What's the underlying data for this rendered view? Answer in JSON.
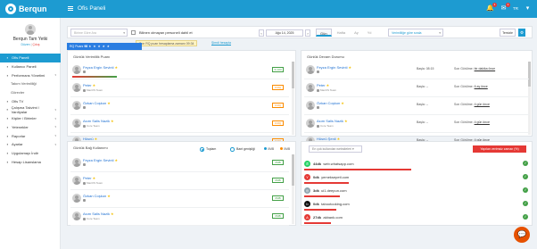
{
  "header": {
    "logo": "Berqun",
    "title": "Ofis Paneli",
    "notif_count": "1",
    "msg_count": "1",
    "lang": "TR"
  },
  "user": {
    "name": "Berqun Tam Yetki",
    "edit": "Düzen",
    "logout": "Çıkış"
  },
  "sidebar": {
    "items": [
      {
        "label": "Ofis Paneli",
        "icon": "home-icon",
        "active": true
      },
      {
        "label": "Kullanıcı Paneli",
        "icon": "user-icon"
      },
      {
        "label": "Performans Yönetimi",
        "icon": "chart-icon",
        "chev": true
      },
      {
        "label": "Takım Verimliliği",
        "sub": true
      },
      {
        "label": "Görevler",
        "sub": true
      },
      {
        "label": "Ofis TV",
        "icon": "tv-icon"
      },
      {
        "label": "Çalışma Takvimi / Vardiyalar",
        "icon": "calendar-icon",
        "chev": true
      },
      {
        "label": "Kişiler / Birimler",
        "icon": "users-icon",
        "chev": true
      },
      {
        "label": "Yetenekler",
        "icon": "star-icon",
        "chev": true
      },
      {
        "label": "Raporlar",
        "icon": "report-icon",
        "chev": true
      },
      {
        "label": "Ayarlar",
        "icon": "gear-icon",
        "chev": true
      },
      {
        "label": "Uygulamayı İndir",
        "icon": "download-icon"
      },
      {
        "label": "Hesap Lisanslama",
        "icon": "license-icon"
      }
    ]
  },
  "filter": {
    "unit_placeholder": "Birime Göre Ara",
    "unregistered_label": "Bilinen olmayan personeli dahil et",
    "date": "Ağu 14, 2025",
    "tabs": [
      "Gün",
      "Hafta",
      "Ay",
      "Yıl"
    ],
    "view": "Verimliliğe göre sırala",
    "clear": "Temizle"
  },
  "alert": {
    "text": "Son RQ puan hesaplama zamanı 09:34",
    "link": "Şimdi hesapla"
  },
  "rq_badge": {
    "label": "RQ Puanı",
    "value": "98",
    "stars": "★ ★ ★ ★ ★"
  },
  "efficiency": {
    "title": "Günlük Verimlilik Puanı",
    "rows": [
      {
        "name": "Feyza Ergin Sevinti",
        "sub": "",
        "badge": "% 100",
        "color": "#43a047",
        "fill": 0.9
      },
      {
        "name": "Peter",
        "sub": "MacOS Team",
        "badge": "0 RQ",
        "color": "#fb8c00",
        "fill": 0
      },
      {
        "name": "Özkan Coşkun",
        "sub": "",
        "badge": "0 RQ",
        "color": "#fb8c00",
        "fill": 0
      },
      {
        "name": "Asım Salis Nazik",
        "sub": "Core Team",
        "badge": "0 RQ",
        "color": "#fb8c00",
        "fill": 0
      },
      {
        "name": "Hüsnü",
        "sub": "",
        "badge": "0 RQ",
        "color": "#fb8c00",
        "fill": 0
      }
    ]
  },
  "connection": {
    "title": "Günlük Bağ Kullanımı",
    "radio_all": "Toplam",
    "radio_unread": "Bant genişliği",
    "legend_dl": "0MB",
    "legend_ul": "0MB",
    "rows": [
      {
        "name": "Feyza Ergin Sevinti",
        "sub": "",
        "badge": "0MB"
      },
      {
        "name": "Peter",
        "sub": "MacOS Team",
        "badge": "0MB"
      },
      {
        "name": "Özkan Coşkun",
        "sub": "",
        "badge": "0MB"
      },
      {
        "name": "Asım Salis Nazik",
        "sub": "Core Team",
        "badge": "0MB"
      }
    ]
  },
  "status": {
    "title": "Günlük Devam Durumu",
    "rows": [
      {
        "name": "Feyza Ergin Sevinti",
        "sub": "",
        "start": "Başla: 08:15",
        "seen": "Son Görülme:",
        "seen_val": "bir dakika önce"
      },
      {
        "name": "Peter",
        "sub": "MacOS Team",
        "start": "Başla: --",
        "seen": "Son Görülme:",
        "seen_val": "6 ay önce"
      },
      {
        "name": "Özkan Coşkun",
        "sub": "",
        "start": "Başla: --",
        "seen": "Son Görülme:",
        "seen_val": "4 gün önce"
      },
      {
        "name": "Asım Salis Nazik",
        "sub": "Core Team",
        "start": "Başla: --",
        "seen": "Son Görülme:",
        "seen_val": "4 gün önce"
      },
      {
        "name": "Hüsnü Şenli",
        "sub": "",
        "start": "Başla: --",
        "seen": "Son Görülme:",
        "seen_val": "4 gün önce"
      }
    ]
  },
  "sites": {
    "select": "En çok kullanılan websiteleri",
    "button": "Yapılan verimsiz zaman (%)",
    "rows": [
      {
        "time": "44dk",
        "site": "web.whatsapp.com",
        "icon": "whatsapp-icon",
        "color": "#25d366",
        "glyph": "✆",
        "fill": 0.6
      },
      {
        "time": "0dk",
        "site": "yemeksepeti.com",
        "icon": "yemeksepeti-icon",
        "color": "#e53935",
        "glyph": "Y",
        "fill": 0.25
      },
      {
        "time": "3dk",
        "site": "ui1.deepun.com",
        "icon": "globe-icon",
        "color": "#90a4ae",
        "glyph": "◎",
        "fill": 0.2
      },
      {
        "time": "0dk",
        "site": "tabootooking.com",
        "icon": "booking-icon",
        "color": "#111",
        "glyph": "b",
        "fill": 0.18
      },
      {
        "time": "27dk",
        "site": "akbank.com",
        "icon": "akbank-icon",
        "color": "#e53935",
        "glyph": "A",
        "fill": 0.15
      }
    ]
  }
}
